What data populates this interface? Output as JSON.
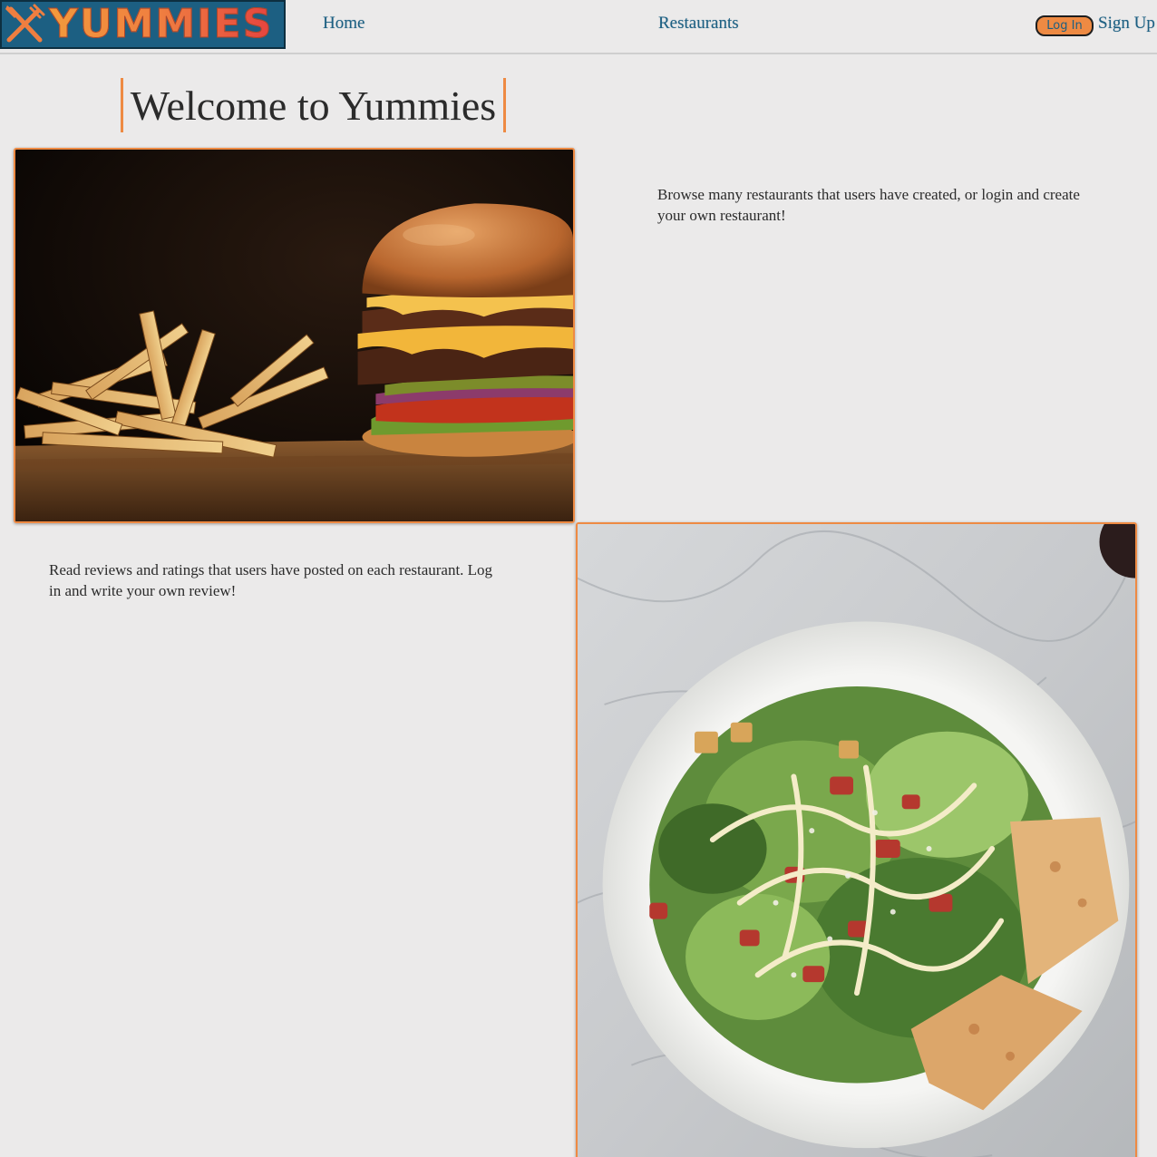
{
  "nav": {
    "logo_text": "YUMMIES",
    "logo_icon": "fork-knife-icon",
    "home_label": "Home",
    "restaurants_label": "Restaurants",
    "login_label": "Log In",
    "signup_label": "Sign Up"
  },
  "hero": {
    "title": "Welcome to Yummies"
  },
  "sections": [
    {
      "image": "burger-and-fries-photo",
      "text": "Browse many restaurants that users have created, or login and create your own restaurant!"
    },
    {
      "image": "caesar-salad-photo",
      "text": "Read reviews and ratings that users have posted on each restaurant. Log in and write your own review!"
    }
  ],
  "colors": {
    "accent": "#ee8a43",
    "link": "#1c5f82",
    "logo_bg": "#1c5f82",
    "background": "#ebeaea"
  }
}
